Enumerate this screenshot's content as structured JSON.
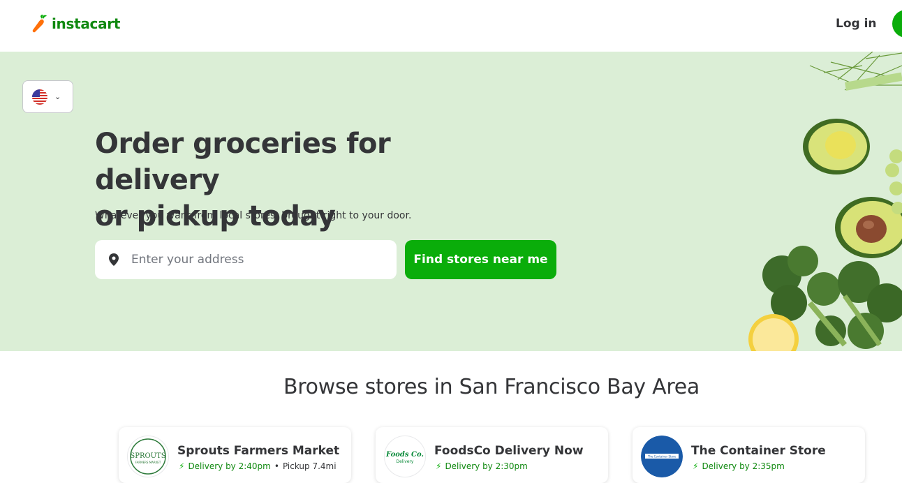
{
  "header": {
    "logo_text": "instacart",
    "login_label": "Log in"
  },
  "hero": {
    "title_line1": "Order groceries for delivery",
    "title_line2": "or pickup today",
    "subtitle": "Whatever you want from local stores, brought right to your door.",
    "address_placeholder": "Enter your address",
    "find_button_label": "Find stores near me",
    "country_flag": "us-flag-icon"
  },
  "browse": {
    "title": "Browse stores in San Francisco Bay Area",
    "stores": [
      {
        "name": "Sprouts Farmers Market",
        "logo_text": "SPROUTS",
        "logo_subtext": "FARMERS MARKET",
        "delivery": "Delivery by 2:40pm",
        "pickup": "Pickup 7.4mi"
      },
      {
        "name": "FoodsCo Delivery Now",
        "logo_text": "Foods Co.",
        "logo_subtext": "Delivery",
        "delivery": "Delivery by 2:30pm"
      },
      {
        "name": "The Container Store",
        "logo_text": "The Container Store",
        "delivery": "Delivery by 2:35pm"
      }
    ]
  },
  "colors": {
    "brand_green": "#0aad0a",
    "dark_green": "#108910",
    "hero_bg": "#dbeed6",
    "text": "#343538",
    "carrot_orange": "#ff7009"
  }
}
